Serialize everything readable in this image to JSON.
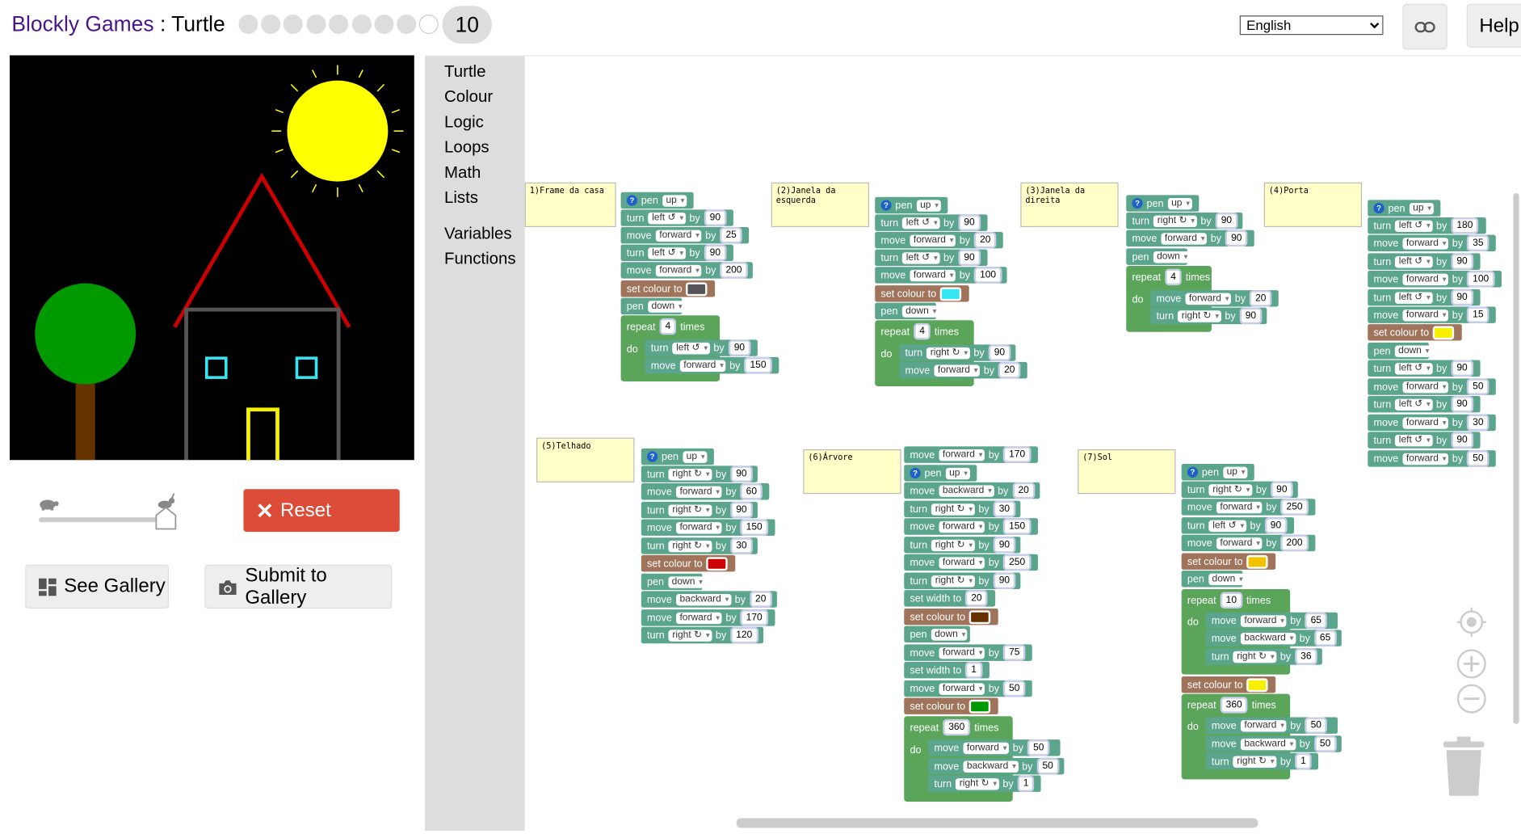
{
  "header": {
    "brand": "Blockly Games",
    "separator": " : ",
    "game": "Turtle",
    "level": "10",
    "language": "English",
    "help_label": "Help",
    "level_dots": 10,
    "level_completed": 9
  },
  "icons": {
    "link": "link-icon",
    "reset": "close-icon",
    "gallery": "gallery-grid-icon",
    "camera": "camera-icon",
    "turtle": "turtle-icon",
    "rabbit": "rabbit-icon"
  },
  "colors": {
    "brand": "#4a148c",
    "reset": "#dd4b39",
    "turtle_block": "#5ba58c",
    "colour_block": "#a0745b",
    "loop_block": "#5ba55b",
    "comment": "#ffffc7"
  },
  "controls": {
    "reset_label": "Reset",
    "see_gallery_label": "See Gallery",
    "submit_gallery_label": "Submit to Gallery",
    "speed": 1.0
  },
  "toolbox": {
    "categories": [
      "Turtle",
      "Colour",
      "Logic",
      "Loops",
      "Math",
      "Lists"
    ],
    "categories2": [
      "Variables",
      "Functions"
    ]
  },
  "comments": {
    "c1": "1)Frame da casa",
    "c2": "(2)Janela da esquerda",
    "c3": "(3)Janela da direita",
    "c4": "(4)Porta",
    "c5": "(5)Telhado",
    "c6": "(6)Árvore",
    "c7": "(7)Sol"
  },
  "words": {
    "pen": "pen",
    "turn": "turn",
    "move": "move",
    "by": "by",
    "set_colour": "set colour to",
    "set_width": "set width to",
    "repeat": "repeat",
    "times": "times",
    "do": "do",
    "up": "up",
    "down": "down",
    "left": "left ↺",
    "right": "right ↻",
    "forward": "forward",
    "backward": "backward",
    "help": "?"
  },
  "code": {
    "s1": {
      "b1": "90",
      "b2": "25",
      "b3": "90",
      "b4": "200",
      "colour": "#555555",
      "repeat": "4",
      "r1": "90",
      "r2": "150"
    },
    "s2": {
      "b1": "90",
      "b2": "20",
      "b3": "90",
      "b4": "100",
      "colour": "#33e6f2",
      "repeat": "4",
      "r1": "90",
      "r2": "20"
    },
    "s3": {
      "b1": "90",
      "b2": "90",
      "repeat": "4",
      "r1": "20",
      "r2": "90"
    },
    "s4": {
      "b1": "180",
      "b2": "35",
      "b3": "90",
      "b4": "100",
      "b5": "90",
      "b6": "15",
      "colour": "#f7f000",
      "b7": "90",
      "b8": "50",
      "b9": "90",
      "b10": "30",
      "b11": "90",
      "b12": "50"
    },
    "s5": {
      "b1": "90",
      "b2": "60",
      "b3": "90",
      "b4": "150",
      "b5": "30",
      "colour": "#cc0000",
      "b6": "20",
      "b7": "170",
      "b8": "120"
    },
    "s6": {
      "b0": "170",
      "b1": "20",
      "b2": "30",
      "b3": "150",
      "b4": "90",
      "b5": "250",
      "b6": "90",
      "width1": "20",
      "colour1": "#663300",
      "b7": "75",
      "width2": "1",
      "b8": "50",
      "colour2": "#009900",
      "repeat": "360",
      "r1": "50",
      "r2": "50",
      "r3": "1"
    },
    "s7": {
      "b1": "90",
      "b2": "250",
      "b3": "90",
      "b4": "200",
      "colour1": "#f2c200",
      "repeat1": "10",
      "r1": "65",
      "r2": "65",
      "r3": "36",
      "colour2": "#f7f000",
      "repeat2": "360",
      "q1": "50",
      "q2": "50",
      "q3": "1"
    }
  }
}
